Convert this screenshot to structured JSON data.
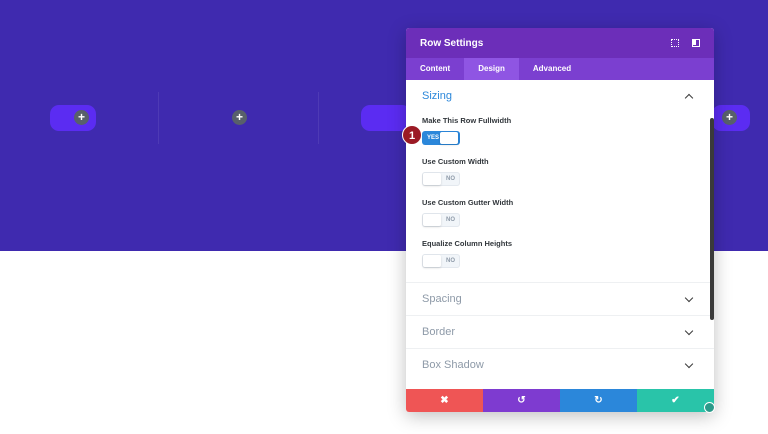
{
  "canvas": {
    "add_glyph": "+"
  },
  "modal": {
    "title": "Row Settings",
    "header_icons": [
      "expand-icon",
      "sidebar-toggle-icon"
    ],
    "tabs": [
      {
        "label": "Content",
        "active": false
      },
      {
        "label": "Design",
        "active": true
      },
      {
        "label": "Advanced",
        "active": false
      }
    ],
    "sizing": {
      "title": "Sizing",
      "options": [
        {
          "label": "Make This Row Fullwidth",
          "state": "YES"
        },
        {
          "label": "Use Custom Width",
          "state": "NO"
        },
        {
          "label": "Use Custom Gutter Width",
          "state": "NO"
        },
        {
          "label": "Equalize Column Heights",
          "state": "NO"
        }
      ]
    },
    "collapsed_groups": [
      "Spacing",
      "Border",
      "Box Shadow"
    ],
    "step_badge": "1",
    "footer": {
      "cancel_glyph": "✖",
      "undo_glyph": "↺",
      "redo_glyph": "↻",
      "save_glyph": "✔"
    }
  },
  "colors": {
    "section_bg": "#3f2aaf",
    "header": "#6c2eb9",
    "tabs": "#7b3fd0",
    "accent": "#2b87da",
    "cancel": "#ef5555",
    "undo": "#7e3bd0",
    "redo": "#2b87da",
    "save": "#29c4a9"
  }
}
